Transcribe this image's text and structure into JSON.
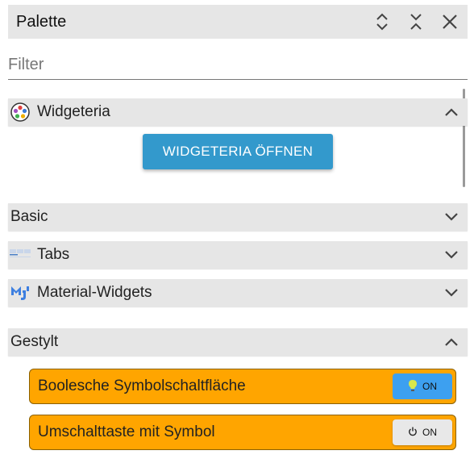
{
  "panel": {
    "title": "Palette"
  },
  "filter": {
    "placeholder": "Filter",
    "value": ""
  },
  "sections": {
    "widgeteria": {
      "label": "Widgeteria",
      "expanded": true,
      "open_button": "WIDGETERIA ÖFFNEN"
    },
    "basic": {
      "label": "Basic",
      "expanded": false
    },
    "tabs": {
      "label": "Tabs",
      "expanded": false
    },
    "material": {
      "label": "Material-Widgets",
      "expanded": false
    },
    "gestylt": {
      "label": "Gestylt",
      "expanded": true
    }
  },
  "widgets": [
    {
      "label": "Boolesche Symbolschaltfläche",
      "toggle_text": "ON",
      "toggle_icon": "lightbulb-icon",
      "toggle_color": "#3da0f0"
    },
    {
      "label": "Umschalttaste mit Symbol",
      "toggle_text": "ON",
      "toggle_icon": "power-icon",
      "toggle_color": "#e8e8e8"
    }
  ],
  "colors": {
    "widget_bg": "#ffa500",
    "button_blue": "#3399cc",
    "header_bg": "#e6e6e6"
  }
}
